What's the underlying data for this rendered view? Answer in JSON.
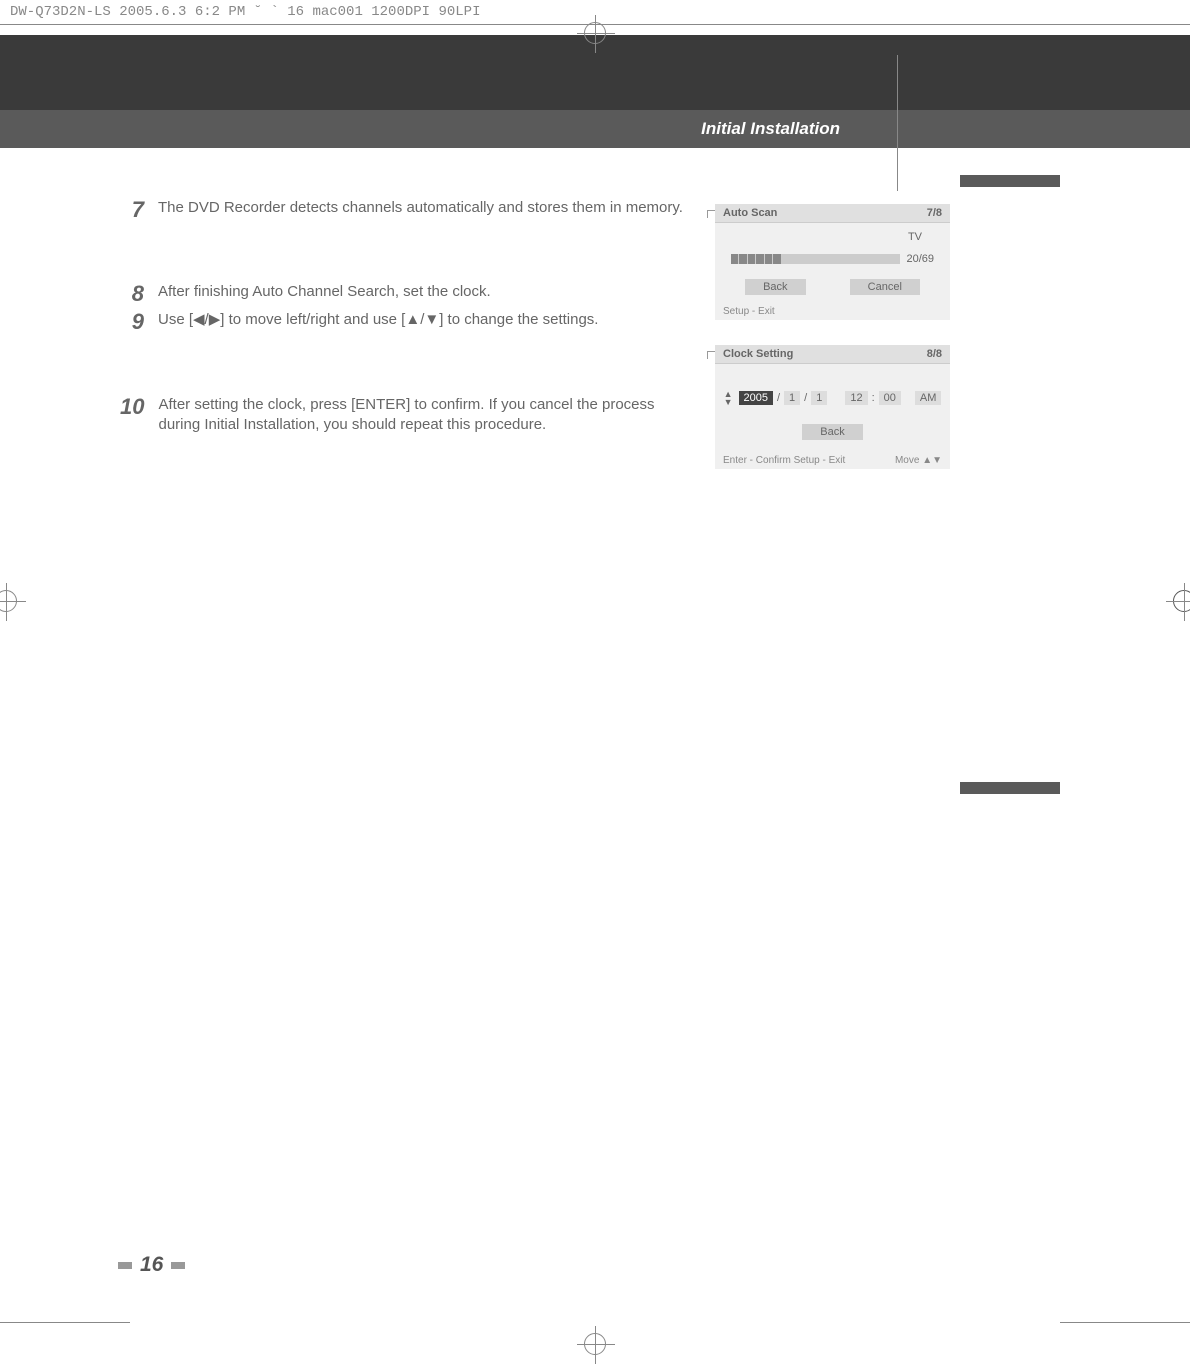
{
  "header_line": "DW-Q73D2N-LS  2005.6.3 6:2 PM  ˘   `  16   mac001  1200DPI 90LPI",
  "section_title": "Initial Installation",
  "steps": {
    "s7_num": "7",
    "s7_text": "The DVD Recorder detects channels automatically and stores them in memory.",
    "s8_num": "8",
    "s8_text": "After finishing Auto Channel Search, set the clock.",
    "s9_num": "9",
    "s9_text": "Use [◀/▶] to move left/right and use [▲/▼] to change the settings.",
    "s10_num": "10",
    "s10_text": "After setting the clock, press [ENTER] to confirm. If you cancel the process during Initial Installation, you should repeat this procedure."
  },
  "ui1": {
    "title": "Auto Scan",
    "progress_page": "7/8",
    "tv": "TV",
    "progress_text": "20/69",
    "back": "Back",
    "cancel": "Cancel",
    "footer": "Setup - Exit"
  },
  "ui2": {
    "title": "Clock Setting",
    "progress_page": "8/8",
    "year": "2005",
    "month": "1",
    "day": "1",
    "hour": "12",
    "minute": "00",
    "ampm": "AM",
    "back": "Back",
    "footer_left": "Enter - Confirm  Setup - Exit",
    "footer_right": "Move  ▲▼"
  },
  "page_number": "16"
}
